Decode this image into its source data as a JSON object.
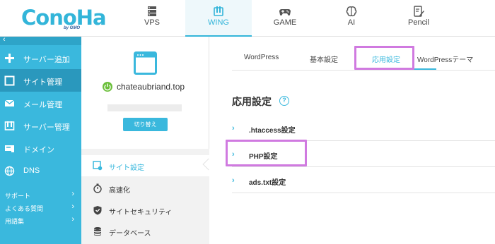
{
  "brand": {
    "logo_text": "ConoHa",
    "logo_sub": "by GMO"
  },
  "top_nav": [
    {
      "id": "vps",
      "label": "VPS",
      "icon": "server-icon"
    },
    {
      "id": "wing",
      "label": "WING",
      "icon": "wing-icon",
      "active": true
    },
    {
      "id": "game",
      "label": "GAME",
      "icon": "gamepad-icon"
    },
    {
      "id": "ai",
      "label": "AI",
      "icon": "brain-icon"
    },
    {
      "id": "pencil",
      "label": "Pencil",
      "icon": "pencil-icon"
    }
  ],
  "sidebar": {
    "collapse_glyph": "‹",
    "items": [
      {
        "label": "サーバー追加",
        "icon": "plus-icon"
      },
      {
        "label": "サイト管理",
        "icon": "window-icon",
        "active": true
      },
      {
        "label": "メール管理",
        "icon": "mail-icon"
      },
      {
        "label": "サーバー管理",
        "icon": "server-icon"
      },
      {
        "label": "ドメイン",
        "icon": "domain-icon"
      },
      {
        "label": "DNS",
        "icon": "globe-icon"
      }
    ],
    "sub_items": [
      {
        "label": "サポート"
      },
      {
        "label": "よくある質問"
      },
      {
        "label": "用語集"
      }
    ]
  },
  "site_panel": {
    "domain": "chateaubriand.top",
    "switch_button": "切り替え",
    "menu": [
      {
        "label": "サイト設定",
        "icon": "site-settings-icon",
        "active": true
      },
      {
        "label": "高速化",
        "icon": "stopwatch-icon"
      },
      {
        "label": "サイトセキュリティ",
        "icon": "shield-icon"
      },
      {
        "label": "データベース",
        "icon": "database-icon"
      }
    ]
  },
  "main": {
    "subtabs": [
      {
        "label": "WordPress"
      },
      {
        "label": "基本設定"
      },
      {
        "label": "応用設定",
        "active": true
      },
      {
        "label": "WordPressテーマ"
      }
    ],
    "section_title": "応用設定",
    "help_glyph": "?",
    "settings": [
      {
        "label": ".htaccess設定"
      },
      {
        "label": "PHP設定",
        "highlighted": true
      },
      {
        "label": "ads.txt設定"
      }
    ]
  },
  "colors": {
    "accent": "#3ab8dd",
    "sidebar_bg": "#3ab8dd",
    "sidebar_active": "#2a98bd",
    "highlight": "#d07ae0",
    "status_ok": "#6bbf3a"
  }
}
